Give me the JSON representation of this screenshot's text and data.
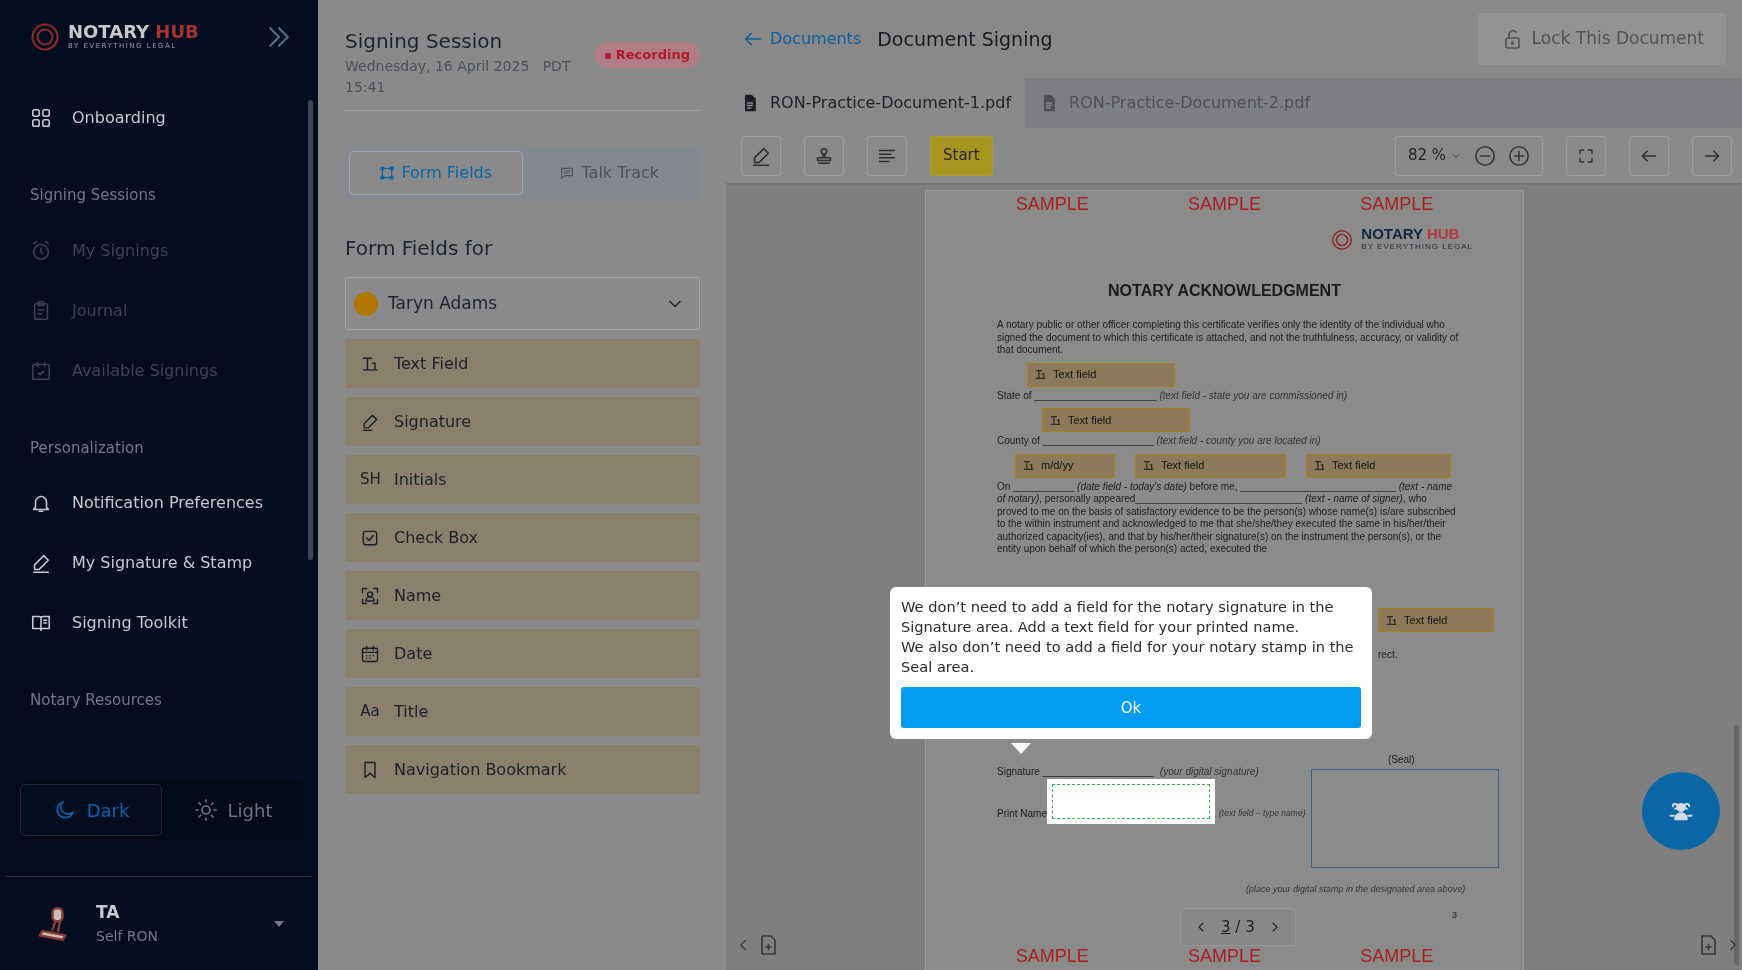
{
  "sidebar": {
    "logo": {
      "name": "NOTARY",
      "accent": "HUB",
      "tagline": "BY EVERYTHING LEGAL"
    },
    "sections": [
      {
        "items": [
          {
            "label": "Onboarding",
            "disabled": false
          }
        ]
      },
      {
        "heading": "Signing Sessions",
        "items": [
          {
            "label": "My Signings",
            "disabled": true
          },
          {
            "label": "Journal",
            "disabled": true
          },
          {
            "label": "Available Signings",
            "disabled": true
          }
        ]
      },
      {
        "heading": "Personalization",
        "items": [
          {
            "label": "Notification Preferences",
            "disabled": false
          },
          {
            "label": "My Signature & Stamp",
            "disabled": false
          },
          {
            "label": "Signing Toolkit",
            "disabled": false
          }
        ]
      },
      {
        "heading": "Notary Resources"
      }
    ],
    "theme_toggle": [
      {
        "label": "Dark",
        "selected": true
      },
      {
        "label": "Light",
        "selected": false
      }
    ],
    "user": {
      "initials": "TA",
      "role": "Self RON"
    }
  },
  "session": {
    "title": "Signing Session",
    "date": "Wednesday, 16 April 2025",
    "timezone": "PDT",
    "time": "15:41",
    "badge": "Recording"
  },
  "panel_tabs": [
    {
      "label": "Form Fields",
      "selected": true
    },
    {
      "label": "Talk Track",
      "selected": false
    }
  ],
  "form_fields_heading": "Form Fields for",
  "signer": {
    "name": "Taryn Adams",
    "color": "#b07800"
  },
  "field_types": [
    {
      "label": "Text Field"
    },
    {
      "label": "Signature"
    },
    {
      "label": "Initials",
      "glyph": "SH"
    },
    {
      "label": "Check Box"
    },
    {
      "label": "Name"
    },
    {
      "label": "Date"
    },
    {
      "label": "Title",
      "glyph": "Aa"
    },
    {
      "label": "Navigation Bookmark"
    }
  ],
  "document_view": {
    "back_link": "Documents",
    "title": "Document Signing",
    "lock_button": "Lock This Document",
    "files": [
      {
        "name": "RON-Practice-Document-1.pdf",
        "selected": true
      },
      {
        "name": "RON-Practice-Document-2.pdf",
        "selected": false
      }
    ],
    "toolbar": {
      "start_button": "Start",
      "zoom": "82 %"
    },
    "page": {
      "watermark_top": [
        "SAMPLE",
        "SAMPLE",
        "SAMPLE"
      ],
      "logo": {
        "name": "NOTARY",
        "accent": "HUB",
        "tagline": "BY EVERYTHING LEGAL"
      },
      "heading": "NOTARY ACKNOWLEDGMENT",
      "intro": "A notary public or other officer completing this certificate verifies only the identity of the individual who signed the document to which this certificate is attached, and not the truthfulness, accuracy, or validity of that document.",
      "state_label": "State of ______________________",
      "state_hint": "(text field - state you are commissioned in)",
      "county_label": "County of ____________________",
      "county_hint": "(text field - county you are located in)",
      "body": "On ___________ *(date field - today's date)* before me, ____________________________ *(text - name of notary)*, personally appeared______________________________ *(text - name of signer)*, who proved to me on the basis of satisfactory evidence to be the person(s) whose name(s) is/are subscribed to the within instrument and acknowledged to me that she/she/they executed the same in his/her/their authorized capacity(ies), and that by his/her/their signature(s) on the instrument the person(s), or the entity upon behalf of which the person(s) acted, executed the",
      "body_tail": "rect.",
      "signature_label": "Signature ____________________",
      "signature_hint": "(your digital signature)",
      "seal_label": "(Seal)",
      "print_name_label": "Print Name",
      "print_name_hint": "(text field – type name)",
      "stamp_note": "(place your digital stamp in the designated area above)",
      "page_number": "3",
      "watermark_bottom": [
        "SAMPLE",
        "SAMPLE",
        "SAMPLE"
      ]
    },
    "placed_fields": [
      {
        "label": "Text field"
      },
      {
        "label": "Text field"
      },
      {
        "label": "m/d/yy"
      },
      {
        "label": "Text field"
      },
      {
        "label": "Text field"
      },
      {
        "label": "Text field"
      }
    ],
    "pager": {
      "current": "3",
      "separator": "/",
      "total": "3"
    }
  },
  "tooltip": {
    "lines": [
      "We don’t need to add a field for the notary signature in the Signature area. Add a text field for your printed name.",
      "We also don’t need to add a field for your notary stamp in the Seal area."
    ],
    "button": "Ok"
  }
}
